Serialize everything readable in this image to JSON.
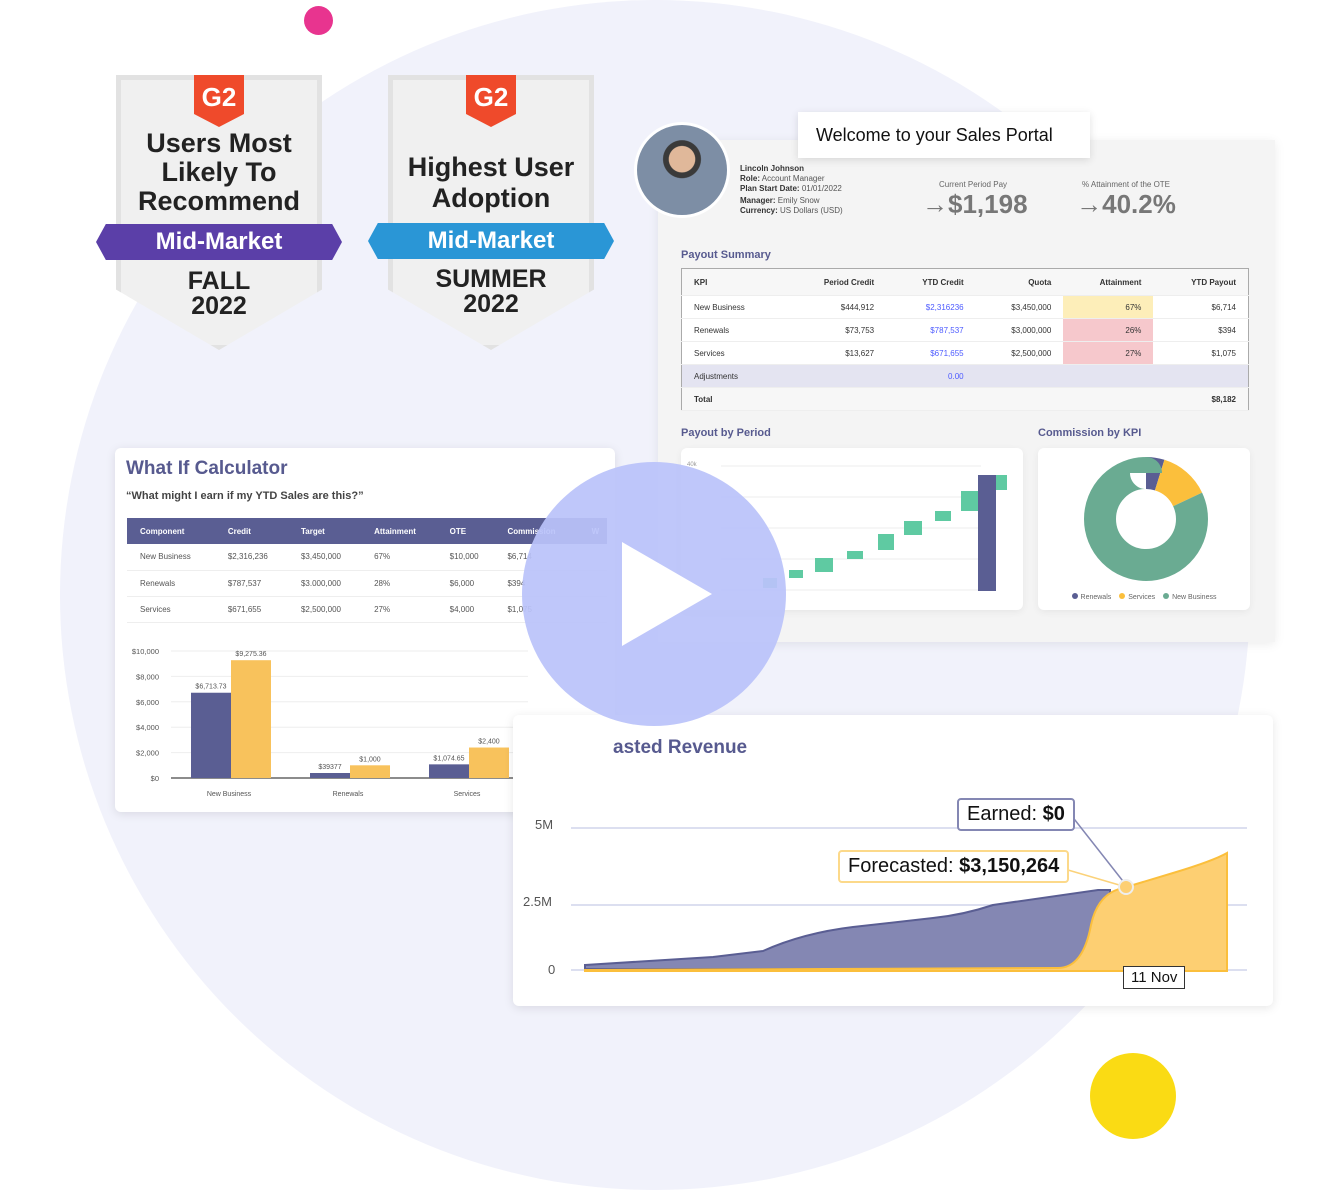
{
  "badges": [
    {
      "logo": "G2",
      "title_lines": [
        "Users Most",
        "Likely To",
        "Recommend"
      ],
      "ribbon": "Mid-Market",
      "ribbon_color": "#5b3fa8",
      "season": "FALL",
      "year": "2022"
    },
    {
      "logo": "G2",
      "title_lines": [
        "Highest User",
        "Adoption"
      ],
      "ribbon": "Mid-Market",
      "ribbon_color": "#2a96d6",
      "season": "SUMMER",
      "year": "2022"
    }
  ],
  "portal": {
    "welcome": "Welcome to your Sales Portal",
    "user": {
      "name": "Lincoln Johnson",
      "role_label": "Role:",
      "role": "Account Manager",
      "start_label": "Plan Start Date:",
      "start": "01/01/2022",
      "manager_label": "Manager:",
      "manager": "Emily Snow",
      "currency_label": "Currency:",
      "currency": "US Dollars (USD)"
    },
    "current_pay_label": "Current Period Pay",
    "current_pay": "→$1,198",
    "attainment_label": "% Attainment of the OTE",
    "attainment": "→40.2%",
    "payout_summary": {
      "title": "Payout Summary",
      "headers": [
        "KPI",
        "Period Credit",
        "YTD Credit",
        "Quota",
        "Attainment",
        "YTD Payout"
      ],
      "rows": [
        [
          "New Business",
          "$444,912",
          "$2,316236",
          "$3,450,000",
          "67%",
          "$6,714"
        ],
        [
          "Renewals",
          "$73,753",
          "$787,537",
          "$3,000,000",
          "26%",
          "$394"
        ],
        [
          "Services",
          "$13,627",
          "$671,655",
          "$2,500,000",
          "27%",
          "$1,075"
        ]
      ],
      "attainment_colors": [
        "#fdeeb9",
        "#f6c8cc",
        "#f6c8cc"
      ],
      "adjustments_label": "Adjustments",
      "adjustments": "0.00",
      "total_label": "Total",
      "total": "$8,182"
    },
    "payout_by_period": {
      "title": "Payout by Period",
      "top_tick": "40k"
    },
    "commission_by_kpi": {
      "title": "Commission by KPI",
      "slices": [
        {
          "name": "Renewals",
          "value": 394,
          "color": "#5a5e93"
        },
        {
          "name": "Services",
          "value": 1075,
          "color": "#fbbf3c"
        },
        {
          "name": "New Business",
          "value": 6714,
          "color": "#6aab92"
        }
      ]
    }
  },
  "what_if": {
    "title": "What If Calculator",
    "subtitle": "“What might I earn if my YTD Sales are this?”",
    "headers": [
      "Component",
      "Credit",
      "Target",
      "Attainment",
      "OTE",
      "Commission",
      "W"
    ],
    "rows": [
      [
        "New Business",
        "$2,316,236",
        "$3,450,000",
        "67%",
        "$10,000",
        "$6,714"
      ],
      [
        "Renewals",
        "$787,537",
        "$3.000,000",
        "28%",
        "$6,000",
        "$394"
      ],
      [
        "Services",
        "$671,655",
        "$2,500,000",
        "27%",
        "$4,000",
        "$1,075"
      ]
    ],
    "chart": {
      "y_ticks": [
        "$10,000",
        "$8,000",
        "$6,000",
        "$4,000",
        "$2,000",
        "$0"
      ],
      "categories": [
        "New Business",
        "Renewals",
        "Services"
      ],
      "series": [
        {
          "values": [
            6713.73,
            393.77,
            1074.65
          ],
          "labels": [
            "$6,713.73",
            "$39377",
            "$1,074.65"
          ],
          "color": "#5a5e93"
        },
        {
          "values": [
            9275.36,
            1000,
            2400
          ],
          "labels": [
            "$9,275.36",
            "$1,000",
            "$2,400"
          ],
          "color": "#f8c25c"
        }
      ]
    }
  },
  "revenue": {
    "title": "asted Revenue",
    "y_ticks": [
      "5M",
      "2.5M",
      "0"
    ],
    "earned_label": "Earned:",
    "earned": "$0",
    "forecast_label": "Forecasted:",
    "forecast": "$3,150,264",
    "date": "11 Nov",
    "earned_color": "#8487b3",
    "forecast_color": "#fdcf72"
  },
  "video": {
    "icon": "play-icon"
  }
}
